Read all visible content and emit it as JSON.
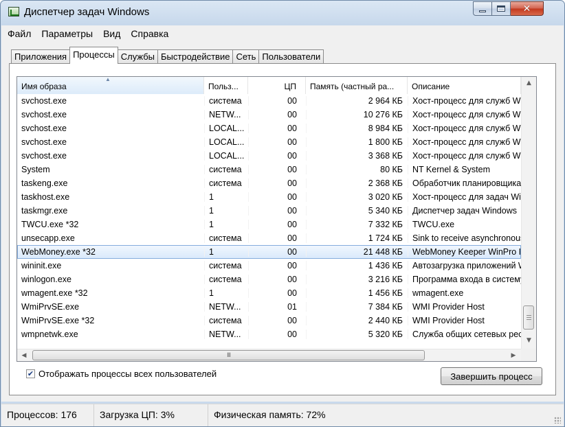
{
  "window": {
    "title": "Диспетчер задач Windows"
  },
  "menu": [
    "Файл",
    "Параметры",
    "Вид",
    "Справка"
  ],
  "tabs": [
    {
      "label": "Приложения",
      "active": false
    },
    {
      "label": "Процессы",
      "active": true
    },
    {
      "label": "Службы",
      "active": false
    },
    {
      "label": "Быстродействие",
      "active": false
    },
    {
      "label": "Сеть",
      "active": false
    },
    {
      "label": "Пользователи",
      "active": false
    }
  ],
  "columns": [
    "Имя образа",
    "Польз...",
    "ЦП",
    "Память (частный ра...",
    "Описание"
  ],
  "rows": [
    {
      "name": "svchost.exe",
      "user": "система",
      "cpu": "00",
      "mem": "2 964 КБ",
      "desc": "Хост-процесс для служб Wi"
    },
    {
      "name": "svchost.exe",
      "user": "NETW...",
      "cpu": "00",
      "mem": "10 276 КБ",
      "desc": "Хост-процесс для служб Wi"
    },
    {
      "name": "svchost.exe",
      "user": "LOCAL...",
      "cpu": "00",
      "mem": "8 984 КБ",
      "desc": "Хост-процесс для служб Wi"
    },
    {
      "name": "svchost.exe",
      "user": "LOCAL...",
      "cpu": "00",
      "mem": "1 800 КБ",
      "desc": "Хост-процесс для служб Wi"
    },
    {
      "name": "svchost.exe",
      "user": "LOCAL...",
      "cpu": "00",
      "mem": "3 368 КБ",
      "desc": "Хост-процесс для служб Wi"
    },
    {
      "name": "System",
      "user": "система",
      "cpu": "00",
      "mem": "80 КБ",
      "desc": "NT Kernel & System"
    },
    {
      "name": "taskeng.exe",
      "user": "система",
      "cpu": "00",
      "mem": "2 368 КБ",
      "desc": "Обработчик планировщика"
    },
    {
      "name": "taskhost.exe",
      "user": "1",
      "cpu": "00",
      "mem": "3 020 КБ",
      "desc": "Хост-процесс для задач Wi"
    },
    {
      "name": "taskmgr.exe",
      "user": "1",
      "cpu": "00",
      "mem": "5 340 КБ",
      "desc": "Диспетчер задач Windows"
    },
    {
      "name": "TWCU.exe *32",
      "user": "1",
      "cpu": "00",
      "mem": "7 332 КБ",
      "desc": "TWCU.exe"
    },
    {
      "name": "unsecapp.exe",
      "user": "система",
      "cpu": "00",
      "mem": "1 724 КБ",
      "desc": "Sink to receive asynchronous"
    },
    {
      "name": "WebMoney.exe *32",
      "user": "1",
      "cpu": "00",
      "mem": "21 448 КБ",
      "desc": "WebMoney Keeper WinPro R",
      "selected": true
    },
    {
      "name": "wininit.exe",
      "user": "система",
      "cpu": "00",
      "mem": "1 436 КБ",
      "desc": "Автозагрузка приложений W"
    },
    {
      "name": "winlogon.exe",
      "user": "система",
      "cpu": "00",
      "mem": "3 216 КБ",
      "desc": "Программа входа в систему"
    },
    {
      "name": "wmagent.exe *32",
      "user": "1",
      "cpu": "00",
      "mem": "1 456 КБ",
      "desc": "wmagent.exe"
    },
    {
      "name": "WmiPrvSE.exe",
      "user": "NETW...",
      "cpu": "01",
      "mem": "7 384 КБ",
      "desc": "WMI Provider Host"
    },
    {
      "name": "WmiPrvSE.exe *32",
      "user": "система",
      "cpu": "00",
      "mem": "2 440 КБ",
      "desc": "WMI Provider Host"
    },
    {
      "name": "wmpnetwk.exe",
      "user": "NETW...",
      "cpu": "00",
      "mem": "5 320 КБ",
      "desc": "Служба общих сетевых рес"
    }
  ],
  "hscroll_glyph": "III",
  "show_all_users": {
    "label": "Отображать процессы всех пользователей",
    "checked": true,
    "mark": "✔"
  },
  "end_process_button": "Завершить процесс",
  "status": {
    "processes": "Процессов: 176",
    "cpu": "Загрузка ЦП: 3%",
    "memory": "Физическая память: 72%"
  }
}
